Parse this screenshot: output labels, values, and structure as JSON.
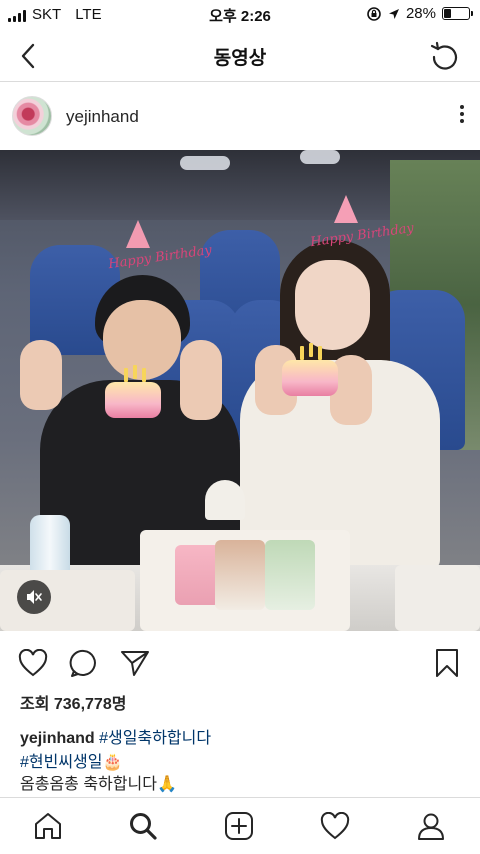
{
  "status_bar": {
    "carrier": "SKT",
    "network": "LTE",
    "time": "오후 2:26",
    "battery_percent": "28%",
    "battery_level": 0.28
  },
  "nav": {
    "title": "동영상",
    "back_icon": "chevron-left-icon",
    "refresh_icon": "refresh-icon"
  },
  "post": {
    "username": "yejinhand",
    "views_label": "조회 736,778명",
    "caption_user": "yejinhand",
    "caption_hashtag1": "#생일축하합니다",
    "caption_hashtag2": "#현빈씨생일",
    "caption_emoji1": "🎂",
    "caption_text": "옴총옴총 축하합니다",
    "caption_emoji2": "🙏",
    "video_sticker_text": "Happy Birthday"
  },
  "actions": {
    "like_icon": "heart-icon",
    "comment_icon": "comment-icon",
    "share_icon": "send-icon",
    "save_icon": "bookmark-icon"
  },
  "tabs": {
    "home_icon": "home-icon",
    "search_icon": "search-icon",
    "add_icon": "add-post-icon",
    "activity_icon": "heart-icon",
    "profile_icon": "profile-icon"
  },
  "colors": {
    "hashtag": "#003569",
    "text": "#262626",
    "divider": "#dbdbdb"
  }
}
